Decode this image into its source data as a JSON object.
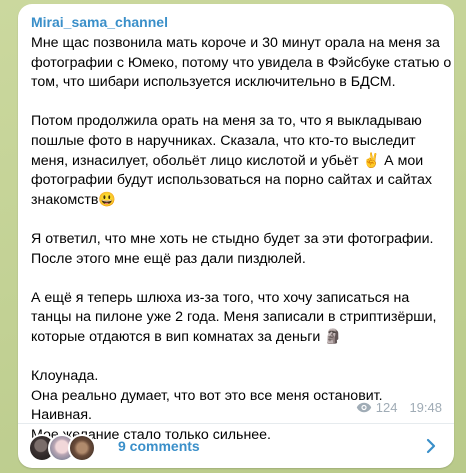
{
  "channel": {
    "name": "Mirai_sama_channel"
  },
  "message": {
    "paragraphs": [
      {
        "lines": [
          "Мне щас позвонила мать короче и 30 минут орала на меня за",
          "фотографии с Юмеко, потому что увидела в Фэйсбуке статью о",
          "том, что шибари используется исключительно в БДСМ."
        ]
      },
      {
        "lines": [
          "Потом продолжила орать на меня за то, что я выкладываю",
          "пошлые фото в наручниках. Сказала, что кто-то выследит",
          "меня, изнасилует, обольёт лицо кислотой и убьёт ✌️  А мои",
          "фотографии будут использоваться на порно сайтах и сайтах",
          "знакомств😃"
        ]
      },
      {
        "lines": [
          "Я ответил, что мне хоть не стыдно будет за эти фотографии.",
          "После этого мне ещё раз дали пиздюлей."
        ]
      },
      {
        "lines": [
          "А ещё я теперь шлюха из-за того, что хочу записаться на",
          "танцы на пилоне уже 2 года. Меня записали в стриптизёрши,",
          "которые отдаются в вип комнатах за деньги 🗿"
        ]
      },
      {
        "lines": [
          "Клоунада.",
          "Она реально думает, что вот это все меня остановит.",
          "Наивная.",
          "Мое желание стало только сильнее."
        ]
      }
    ],
    "views": "124",
    "time": "19:48"
  },
  "comments": {
    "label": "9 comments",
    "avatar_count": 3
  },
  "icons": {
    "views": "eye-icon",
    "open_comments": "chevron-right-icon"
  },
  "colors": {
    "accent": "#3a8fc9",
    "meta": "#a0acb6",
    "bubble": "#ffffff",
    "wallpaper": "#c4d39a"
  }
}
